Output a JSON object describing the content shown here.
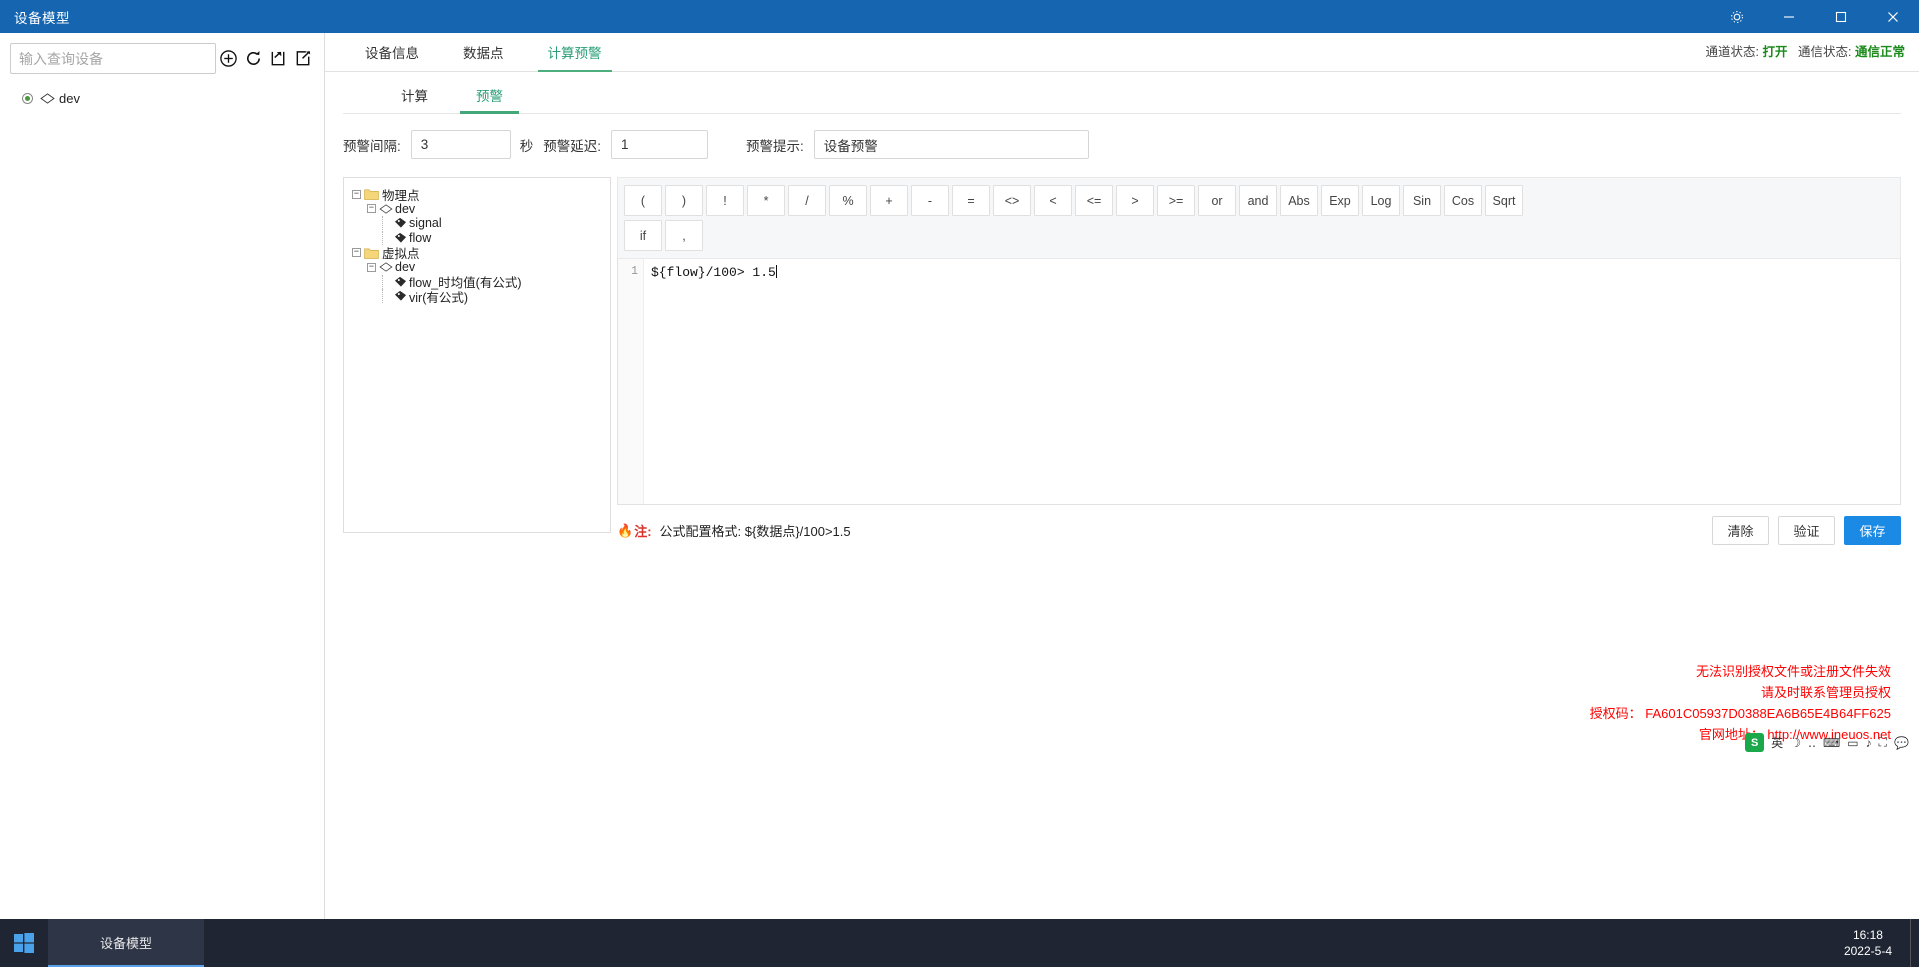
{
  "window": {
    "title": "设备模型",
    "controls": {
      "settings": "⚙",
      "minimize": "—",
      "maximize": "☐",
      "close": "✕"
    }
  },
  "sidebar": {
    "search_placeholder": "输入查询设备",
    "icons": [
      {
        "name": "add-device-icon",
        "glyph": "⊕"
      },
      {
        "name": "refresh-icon",
        "glyph": "⟳"
      },
      {
        "name": "import-icon",
        "glyph": "⬆"
      },
      {
        "name": "export-icon",
        "glyph": "⬈"
      }
    ],
    "tree": [
      {
        "label": "dev",
        "selected": true
      }
    ]
  },
  "header": {
    "tabs": [
      {
        "label": "设备信息",
        "active": false
      },
      {
        "label": "数据点",
        "active": false
      },
      {
        "label": "计算预警",
        "active": true
      }
    ],
    "channel_status_label": "通道状态:",
    "channel_status_value": "打开",
    "comm_status_label": "通信状态:",
    "comm_status_value": "通信正常"
  },
  "subtabs": [
    {
      "label": "计算",
      "active": false
    },
    {
      "label": "预警",
      "active": true
    }
  ],
  "form": {
    "interval_label": "预警间隔:",
    "interval_value": "3",
    "interval_unit": "秒",
    "delay_label": "预警延迟:",
    "delay_value": "1",
    "tip_label": "预警提示:",
    "tip_value": "设备预警"
  },
  "point_tree": [
    {
      "label": "物理点",
      "type": "folder",
      "depth": 0,
      "toggle": "−"
    },
    {
      "label": "dev",
      "type": "device",
      "depth": 1,
      "toggle": "−"
    },
    {
      "label": "signal",
      "type": "tag",
      "depth": 2,
      "toggle": ""
    },
    {
      "label": "flow",
      "type": "tag",
      "depth": 2,
      "toggle": ""
    },
    {
      "label": "虚拟点",
      "type": "folder",
      "depth": 0,
      "toggle": "−"
    },
    {
      "label": "dev",
      "type": "device",
      "depth": 1,
      "toggle": "−"
    },
    {
      "label": "flow_时均值(有公式)",
      "type": "tag",
      "depth": 2,
      "toggle": ""
    },
    {
      "label": "vir(有公式)",
      "type": "tag",
      "depth": 2,
      "toggle": ""
    }
  ],
  "operators": {
    "row1": [
      "(",
      ")",
      "!",
      "*",
      "/",
      "%",
      "+",
      "-",
      "=",
      "<>",
      "<",
      "<=",
      ">",
      ">=",
      "or",
      "and",
      "Abs",
      "Exp",
      "Log",
      "Sin",
      "Cos",
      "Sqrt"
    ],
    "row2": [
      "if",
      ","
    ]
  },
  "editor": {
    "line_number": "1",
    "formula": "${flow}/100> 1.5"
  },
  "footer": {
    "note_icon": "🔥",
    "note_label": "注:",
    "note_text": "公式配置格式: ${数据点}/100>1.5",
    "buttons": [
      {
        "label": "清除",
        "primary": false
      },
      {
        "label": "验证",
        "primary": false
      },
      {
        "label": "保存",
        "primary": true
      }
    ]
  },
  "license_warning": {
    "line1": "无法识别授权文件或注册文件失效",
    "line2": "请及时联系管理员授权",
    "line3": "授权码： FA601C05937D0388EA6B65E4B64FF625",
    "line4": "官网地址： http://www.ineuos.net"
  },
  "tray": {
    "ime_badge": "S",
    "ime_label": "英",
    "items": [
      "☽",
      "‥",
      "⌨",
      "▭",
      "♪",
      "⛶"
    ]
  },
  "taskbar": {
    "start_icon": "windows-logo",
    "task_label": "设备模型",
    "time": "16:18",
    "date": "2022-5-4"
  },
  "colors": {
    "titlebar": "#1565b0",
    "accent_green": "#2a9d77",
    "primary_button": "#1a8ae5",
    "warning_red": "#ff0000",
    "status_green": "#1a8a1a"
  }
}
